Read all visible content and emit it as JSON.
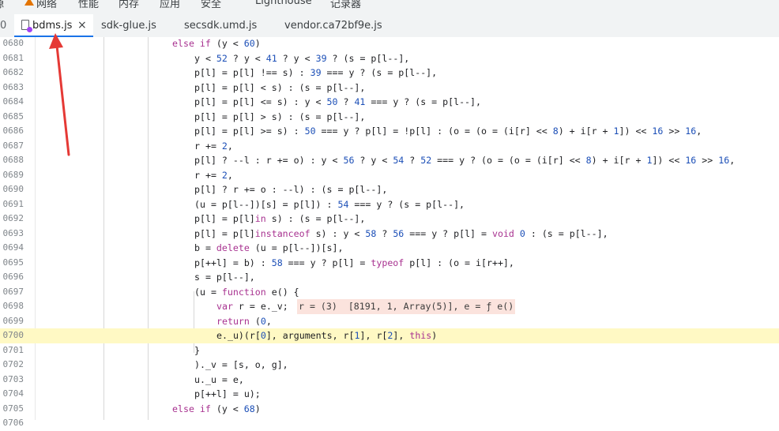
{
  "devtools_top_tabs": [
    {
      "label": "源",
      "icon": ""
    },
    {
      "label": "网络",
      "icon": "warning-icon"
    },
    {
      "label": "性能",
      "icon": ""
    },
    {
      "label": "内存",
      "icon": ""
    },
    {
      "label": "应用",
      "icon": ""
    },
    {
      "label": "安全",
      "icon": ""
    },
    {
      "label": "Lighthouse",
      "icon": ""
    },
    {
      "label": "记录器",
      "icon": ""
    }
  ],
  "file_tabs": [
    {
      "label": "bdms.js",
      "active": true,
      "closable": true
    },
    {
      "label": "sdk-glue.js",
      "active": false
    },
    {
      "label": "secsdk.umd.js",
      "active": false
    },
    {
      "label": "vendor.ca72bf9e.js",
      "active": false
    }
  ],
  "left_cut": "0",
  "close_glyph": "×",
  "colors": {
    "accent": "#1a73e8",
    "highlight_line": "#fff9c4",
    "arrow": "#e53935",
    "keyword": "#a83290",
    "number": "#1c4fb7"
  },
  "editor": {
    "lines": [
      {
        "num": "0680",
        "text": "else if (y < 60)",
        "indent": 0
      },
      {
        "num": "0681",
        "text": "y < 52 ? y < 41 ? y < 39 ? (s = p[l--],",
        "indent": 1
      },
      {
        "num": "0682",
        "text": "p[l] = p[l] !== s) : 39 === y ? (s = p[l--],",
        "indent": 1
      },
      {
        "num": "0683",
        "text": "p[l] = p[l] < s) : (s = p[l--],",
        "indent": 1
      },
      {
        "num": "0684",
        "text": "p[l] = p[l] <= s) : y < 50 ? 41 === y ? (s = p[l--],",
        "indent": 1
      },
      {
        "num": "0685",
        "text": "p[l] = p[l] > s) : (s = p[l--],",
        "indent": 1
      },
      {
        "num": "0686",
        "text": "p[l] = p[l] >= s) : 50 === y ? p[l] = !p[l] : (o = (o = (i[r] << 8) + i[r + 1]) << 16 >> 16,",
        "indent": 1
      },
      {
        "num": "0687",
        "text": "r += 2,",
        "indent": 1
      },
      {
        "num": "0688",
        "text": "p[l] ? --l : r += o) : y < 56 ? y < 54 ? 52 === y ? (o = (o = (i[r] << 8) + i[r + 1]) << 16 >> 16,",
        "indent": 1
      },
      {
        "num": "0689",
        "text": "r += 2,",
        "indent": 1
      },
      {
        "num": "0690",
        "text": "p[l] ? r += o : --l) : (s = p[l--],",
        "indent": 1
      },
      {
        "num": "0691",
        "text": "(u = p[l--])[s] = p[l]) : 54 === y ? (s = p[l--],",
        "indent": 1
      },
      {
        "num": "0692",
        "text": "p[l] = p[l]in s) : (s = p[l--],",
        "indent": 1
      },
      {
        "num": "0693",
        "text": "p[l] = p[l]instanceof s) : y < 58 ? 56 === y ? p[l] = void 0 : (s = p[l--],",
        "indent": 1
      },
      {
        "num": "0694",
        "text": "b = delete (u = p[l--])[s],",
        "indent": 1
      },
      {
        "num": "0695",
        "text": "p[++l] = b) : 58 === y ? p[l] = typeof p[l] : (o = i[r++],",
        "indent": 1
      },
      {
        "num": "0696",
        "text": "s = p[l--],",
        "indent": 1
      },
      {
        "num": "0697",
        "text": "(u = function e() {",
        "indent": 1
      },
      {
        "num": "0698",
        "text": "var r = e._v;",
        "indent": 2,
        "inline_value": "r = (3)  [8191, 1, Array(5)], e = ƒ e()"
      },
      {
        "num": "0699",
        "text": "return (0,",
        "indent": 2
      },
      {
        "num": "0700",
        "text": "e._u)(r[0], arguments, r[1], r[2], this)",
        "indent": 2,
        "highlighted": true
      },
      {
        "num": "0701",
        "text": "}",
        "indent": 1
      },
      {
        "num": "0702",
        "text": ")._v = [s, o, g],",
        "indent": 1
      },
      {
        "num": "0703",
        "text": "u._u = e,",
        "indent": 1
      },
      {
        "num": "0704",
        "text": "p[++l] = u);",
        "indent": 1
      },
      {
        "num": "0705",
        "text": "else if (y < 68)",
        "indent": 0
      },
      {
        "num": "0706",
        "text": "",
        "indent": 1
      }
    ]
  }
}
